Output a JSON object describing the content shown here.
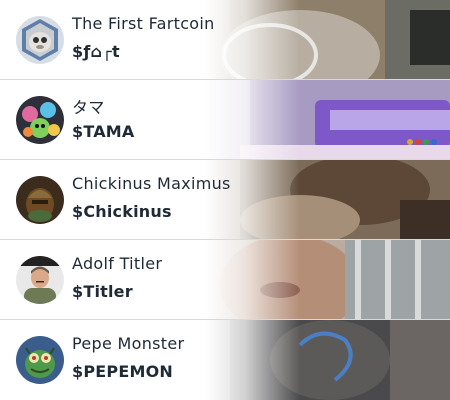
{
  "tokens": [
    {
      "name": "The First Fartcoin",
      "ticker": "$ƒ⌂┌t",
      "avatar_icon": "silver-creature-hexagon-badge",
      "accent": "#6f8fb8"
    },
    {
      "name": "タマ",
      "ticker": "$TAMA",
      "avatar_icon": "cartoon-creatures-collage",
      "accent": "#8a5bd0"
    },
    {
      "name": "Chickinus Maximus",
      "ticker": "$Chickinus",
      "avatar_icon": "warrior-helmet-painting",
      "accent": "#6e4a25"
    },
    {
      "name": "Adolf Titler",
      "ticker": "$Titler",
      "avatar_icon": "portrait-photo",
      "accent": "#404040"
    },
    {
      "name": "Pepe Monster",
      "ticker": "$PEPEMON",
      "avatar_icon": "green-frog-monster",
      "accent": "#3d7a3f"
    }
  ]
}
